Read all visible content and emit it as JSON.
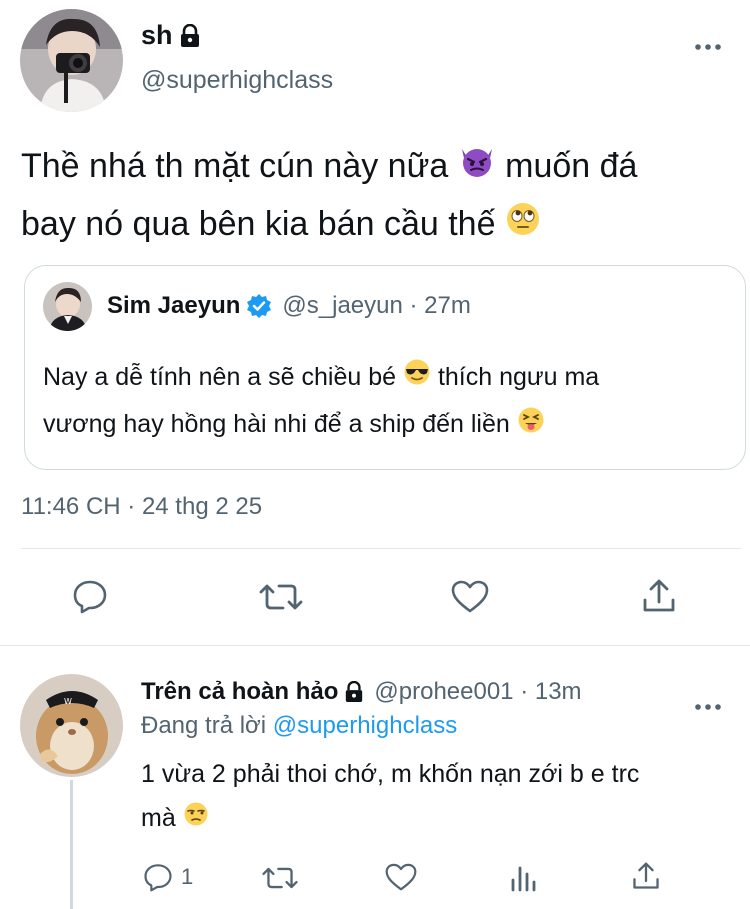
{
  "main_tweet": {
    "display_name": "sh",
    "handle": "@superhighclass",
    "text_line1": "Thề nhá th mặt cún này nữa",
    "text_line1b": "muốn đá",
    "text_line2": "bay nó qua bên kia bán cầu thế",
    "timestamp": "11:46 CH · 24 thg 2 25",
    "emoji_1": "devil-face-icon",
    "emoji_2": "rolling-eyes-icon"
  },
  "quote": {
    "display_name": "Sim Jaeyun",
    "handle": "@s_jaeyun · 27m",
    "text_line1a": "Nay a dễ tính nên a sẽ chiều bé",
    "text_line1b": "thích ngưu ma",
    "text_line2": "vương hay hồng hài nhi để a ship đến liền"
  },
  "reply": {
    "display_name": "Trên cả hoàn hảo",
    "handle": "@prohee001 · 13m",
    "replying_prefix": "Đang trả lời",
    "replying_to": "@superhighclass",
    "text_line1": "1 vừa 2 phải thoi chớ, m khốn nạn zới b e trc",
    "text_line2": "mà",
    "reply_count": "1"
  },
  "colors": {
    "text": "#0f1419",
    "muted": "#536471",
    "accent": "#1d9bf0",
    "border": "#cfd9de"
  }
}
